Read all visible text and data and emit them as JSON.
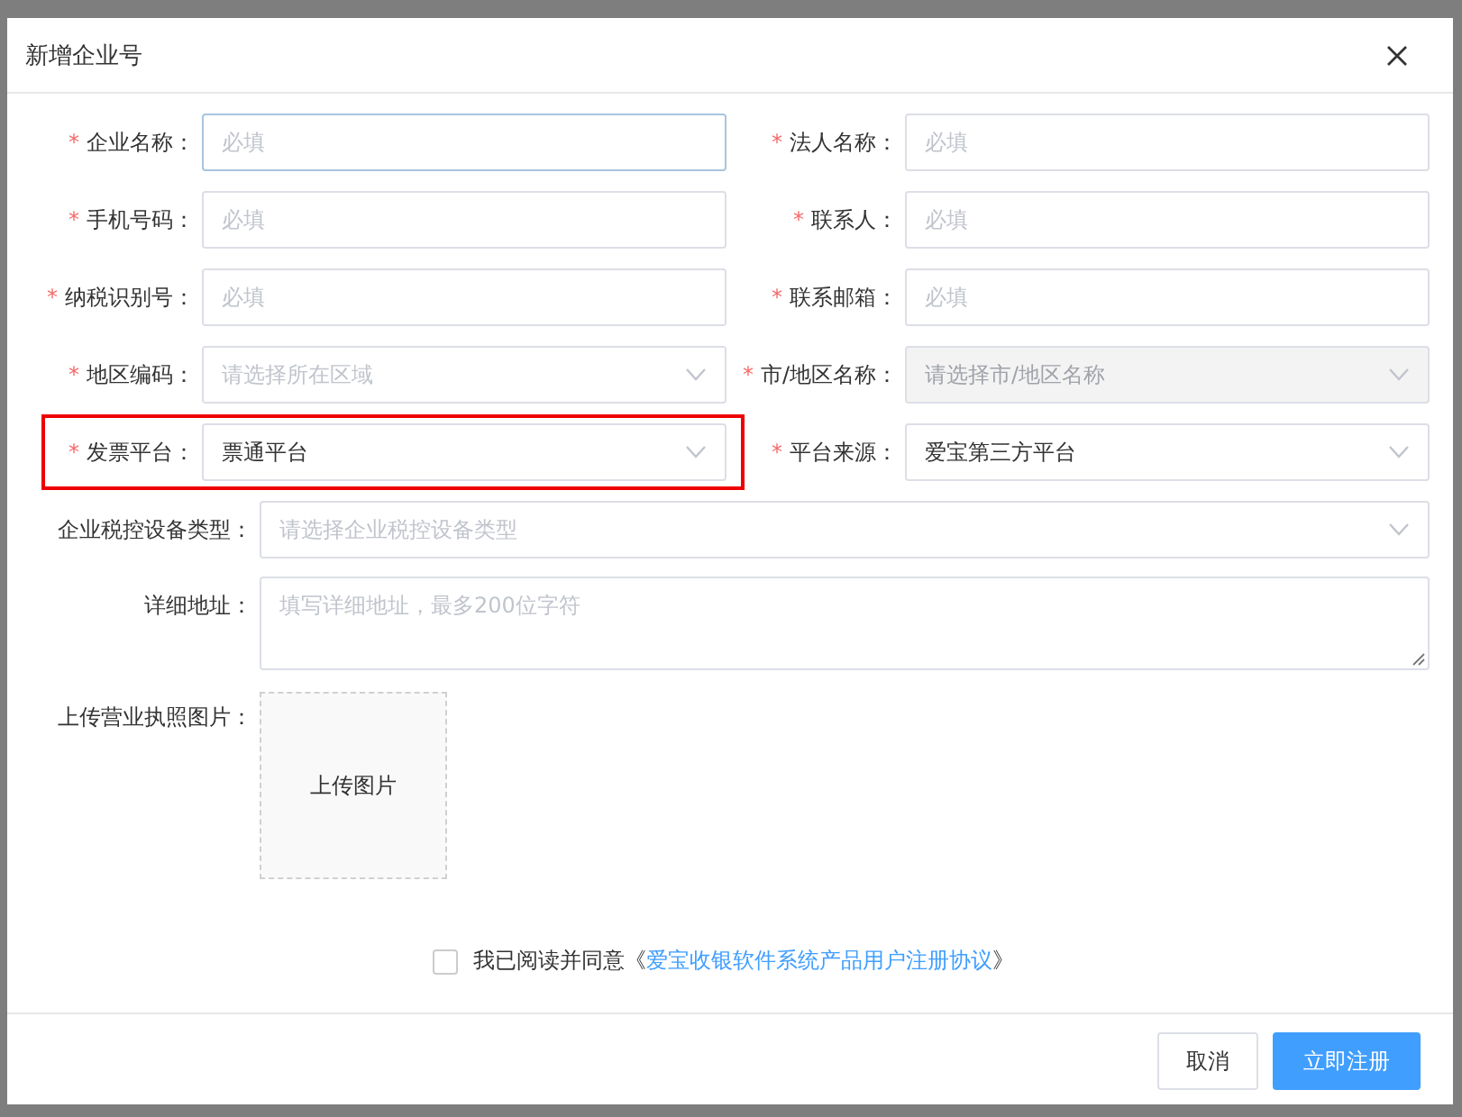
{
  "dialog": {
    "title": "新增企业号"
  },
  "pair_rows": [
    [
      {
        "label": "企业名称：",
        "required_mark": "*",
        "kind": "input",
        "placeholder": "必填",
        "focused": true,
        "disabled": false
      },
      {
        "label": "法人名称：",
        "required_mark": "*",
        "kind": "input",
        "placeholder": "必填",
        "focused": false,
        "disabled": false
      }
    ],
    [
      {
        "label": "手机号码：",
        "required_mark": "*",
        "kind": "input",
        "placeholder": "必填",
        "focused": false,
        "disabled": false
      },
      {
        "label": "联系人：",
        "required_mark": "*",
        "kind": "input",
        "placeholder": "必填",
        "focused": false,
        "disabled": false
      }
    ],
    [
      {
        "label": "纳税识别号：",
        "required_mark": "*",
        "kind": "input",
        "placeholder": "必填",
        "focused": false,
        "disabled": false
      },
      {
        "label": "联系邮箱：",
        "required_mark": "*",
        "kind": "input",
        "placeholder": "必填",
        "focused": false,
        "disabled": false
      }
    ],
    [
      {
        "label": "地区编码：",
        "required_mark": "*",
        "kind": "select",
        "placeholder": "请选择所在区域",
        "focused": false,
        "disabled": false
      },
      {
        "label": "市/地区名称：",
        "required_mark": "*",
        "kind": "select",
        "placeholder": "请选择市/地区名称",
        "focused": false,
        "disabled": true
      }
    ],
    [
      {
        "label": "发票平台：",
        "required_mark": "*",
        "kind": "select",
        "value": "票通平台",
        "focused": false,
        "disabled": false,
        "highlighted": true
      },
      {
        "label": "平台来源：",
        "required_mark": "*",
        "kind": "select",
        "value": "爱宝第三方平台",
        "focused": false,
        "disabled": false
      }
    ]
  ],
  "wide_rows": [
    {
      "label": "企业税控设备类型：",
      "kind": "select",
      "placeholder": "请选择企业税控设备类型"
    },
    {
      "label": "详细地址：",
      "kind": "textarea",
      "placeholder": "填写详细地址，最多200位字符"
    },
    {
      "label": "上传营业执照图片：",
      "kind": "upload",
      "button": "上传图片"
    }
  ],
  "agreement": {
    "checked": false,
    "text": "我已阅读并同意《",
    "link": "爱宝收银软件系统产品用户注册协议",
    "suffix": "》"
  },
  "buttons": [
    {
      "label": "取消",
      "primary": false
    },
    {
      "label": "立即注册",
      "primary": true
    }
  ]
}
